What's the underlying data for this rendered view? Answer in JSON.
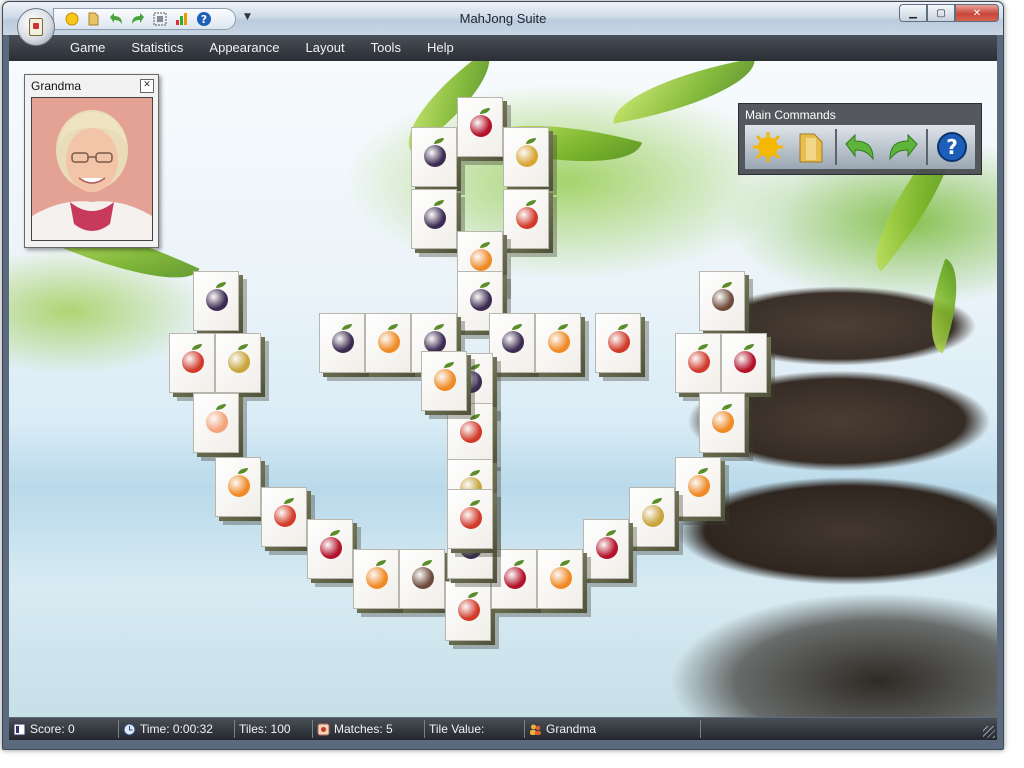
{
  "window": {
    "title": "MahJong Suite"
  },
  "quick_access": [
    {
      "name": "new-game-icon"
    },
    {
      "name": "open-icon"
    },
    {
      "name": "undo-icon"
    },
    {
      "name": "redo-icon"
    },
    {
      "name": "layout-icon"
    },
    {
      "name": "statistics-icon"
    },
    {
      "name": "help-icon"
    }
  ],
  "menu": [
    "Game",
    "Statistics",
    "Appearance",
    "Layout",
    "Tools",
    "Help"
  ],
  "player_panel": {
    "name": "Grandma"
  },
  "commands_panel": {
    "title": "Main Commands",
    "buttons": [
      "new-game-icon",
      "open-folder-icon",
      "undo-icon",
      "redo-icon",
      "help-icon"
    ]
  },
  "status": {
    "score": "Score: 0",
    "time": "Time: 0:00:32",
    "tiles": "Tiles: 100",
    "matches": "Matches: 5",
    "tile_value": "Tile Value:",
    "player": "Grandma"
  },
  "colors": {
    "accent": "#2a2e35",
    "tile_face": "#ffffff",
    "tile_side": "#4e5138"
  },
  "board": {
    "tile_theme": "fruit",
    "tiles": [
      {
        "fruit": "grape"
      },
      {
        "fruit": "cherry"
      },
      {
        "fruit": "pineapple"
      },
      {
        "fruit": "grape"
      },
      {
        "fruit": "apple"
      },
      {
        "fruit": "apricot"
      },
      {
        "fruit": "grape"
      },
      {
        "fruit": "fig"
      },
      {
        "fruit": "grape"
      },
      {
        "fruit": "apple"
      },
      {
        "fruit": "pear"
      },
      {
        "fruit": "grape"
      },
      {
        "fruit": "apricot"
      },
      {
        "fruit": "grape"
      },
      {
        "fruit": "grape"
      },
      {
        "fruit": "apricot"
      },
      {
        "fruit": "apple"
      },
      {
        "fruit": "apple"
      },
      {
        "fruit": "cherry"
      },
      {
        "fruit": "peach"
      },
      {
        "fruit": "grape"
      },
      {
        "fruit": "apple"
      },
      {
        "fruit": "apricot"
      },
      {
        "fruit": "apricot"
      },
      {
        "fruit": "pear"
      },
      {
        "fruit": "apricot"
      },
      {
        "fruit": "apple"
      },
      {
        "fruit": "pear"
      },
      {
        "fruit": "cherry"
      },
      {
        "fruit": "cherry"
      },
      {
        "fruit": "apricot"
      },
      {
        "fruit": "fig"
      },
      {
        "fruit": "apple"
      },
      {
        "fruit": "cherry"
      },
      {
        "fruit": "apricot"
      },
      {
        "fruit": "grape"
      },
      {
        "fruit": "apple"
      },
      {
        "fruit": "apricot"
      }
    ]
  }
}
